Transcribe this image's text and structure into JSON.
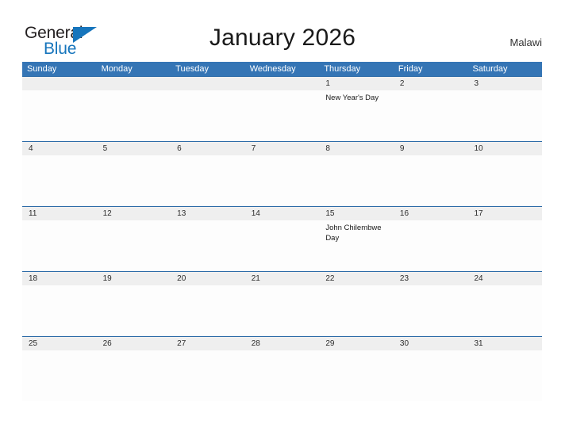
{
  "brand": {
    "name_part1": "General",
    "name_part2": "Blue",
    "triangle_icon": "triangle-right-icon",
    "primary_color": "#1675bc"
  },
  "header": {
    "title": "January 2026",
    "locale": "Malawi",
    "header_bg_color": "#3575b5",
    "row_divider_color": "#2e6ca8",
    "date_strip_color": "#efefef"
  },
  "calendar": {
    "weekdays": [
      "Sunday",
      "Monday",
      "Tuesday",
      "Wednesday",
      "Thursday",
      "Friday",
      "Saturday"
    ],
    "weeks": [
      {
        "days": [
          {
            "date": "",
            "event": ""
          },
          {
            "date": "",
            "event": ""
          },
          {
            "date": "",
            "event": ""
          },
          {
            "date": "",
            "event": ""
          },
          {
            "date": "1",
            "event": "New Year's Day"
          },
          {
            "date": "2",
            "event": ""
          },
          {
            "date": "3",
            "event": ""
          }
        ]
      },
      {
        "days": [
          {
            "date": "4",
            "event": ""
          },
          {
            "date": "5",
            "event": ""
          },
          {
            "date": "6",
            "event": ""
          },
          {
            "date": "7",
            "event": ""
          },
          {
            "date": "8",
            "event": ""
          },
          {
            "date": "9",
            "event": ""
          },
          {
            "date": "10",
            "event": ""
          }
        ]
      },
      {
        "days": [
          {
            "date": "11",
            "event": ""
          },
          {
            "date": "12",
            "event": ""
          },
          {
            "date": "13",
            "event": ""
          },
          {
            "date": "14",
            "event": ""
          },
          {
            "date": "15",
            "event": "John Chilembwe Day"
          },
          {
            "date": "16",
            "event": ""
          },
          {
            "date": "17",
            "event": ""
          }
        ]
      },
      {
        "days": [
          {
            "date": "18",
            "event": ""
          },
          {
            "date": "19",
            "event": ""
          },
          {
            "date": "20",
            "event": ""
          },
          {
            "date": "21",
            "event": ""
          },
          {
            "date": "22",
            "event": ""
          },
          {
            "date": "23",
            "event": ""
          },
          {
            "date": "24",
            "event": ""
          }
        ]
      },
      {
        "days": [
          {
            "date": "25",
            "event": ""
          },
          {
            "date": "26",
            "event": ""
          },
          {
            "date": "27",
            "event": ""
          },
          {
            "date": "28",
            "event": ""
          },
          {
            "date": "29",
            "event": ""
          },
          {
            "date": "30",
            "event": ""
          },
          {
            "date": "31",
            "event": ""
          }
        ]
      }
    ]
  }
}
